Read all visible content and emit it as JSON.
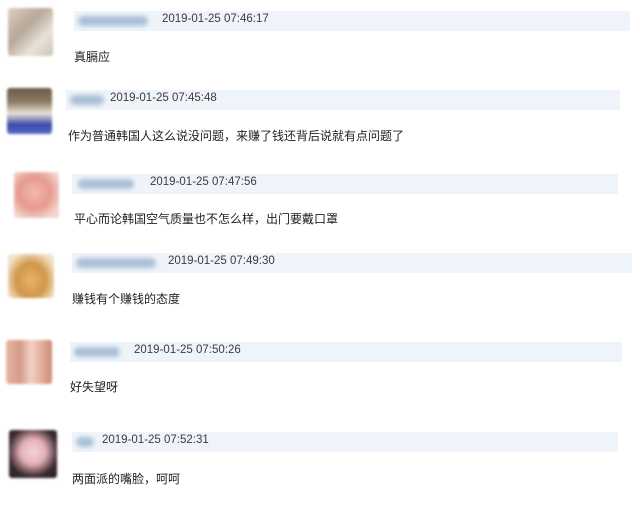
{
  "comments": [
    {
      "time": "2019-01-25 07:46:17",
      "text": "真膈应"
    },
    {
      "time": "2019-01-25 07:45:48",
      "text": "作为普通韩国人这么说没问题，来赚了钱还背后说就有点问题了"
    },
    {
      "time": "2019-01-25 07:47:56",
      "text": "平心而论韩国空气质量也不怎么样，出门要戴口罩"
    },
    {
      "time": "2019-01-25 07:49:30",
      "text": "赚钱有个赚钱的态度"
    },
    {
      "time": "2019-01-25 07:50:26",
      "text": "好失望呀"
    },
    {
      "time": "2019-01-25 07:52:31",
      "text": "两面派的嘴脸，呵呵"
    }
  ]
}
